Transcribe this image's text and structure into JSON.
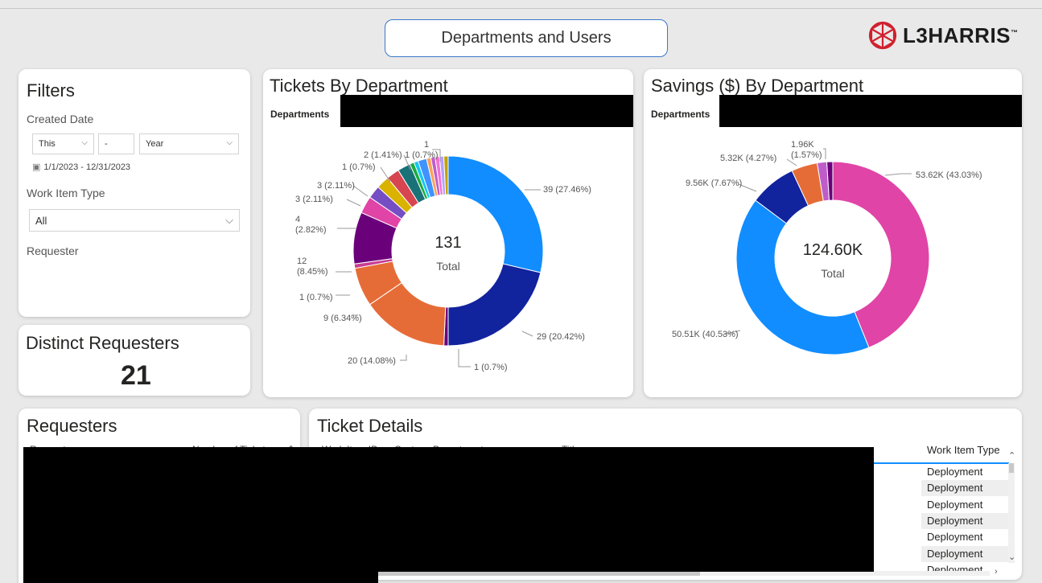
{
  "header": {
    "title_button": "Departments and Users",
    "logo_text": "L3HARRIS",
    "logo_tm": "™"
  },
  "filters": {
    "title": "Filters",
    "created_date_label": "Created Date",
    "relative_mode": "This",
    "relative_count": "-",
    "relative_unit": "Year",
    "date_range": "1/1/2023 - 12/31/2023",
    "work_item_type_label": "Work Item Type",
    "work_item_type_value": "All",
    "requester_label": "Requester"
  },
  "distinct_requesters": {
    "title": "Distinct Requesters",
    "value": "21"
  },
  "tickets_chart": {
    "title": "Tickets By Department",
    "legend_label": "Departments",
    "center_value": "131",
    "center_label": "Total"
  },
  "savings_chart": {
    "title": "Savings ($) By Department",
    "legend_label": "Departments",
    "center_value": "124.60K",
    "center_label": "Total"
  },
  "requesters": {
    "title": "Requesters",
    "col_requester": "Requester",
    "col_tickets": "Number of Tickets"
  },
  "ticket_details": {
    "title": "Ticket Details",
    "col_work_item_id": "Work Item ID",
    "col_department": "Custom_Department",
    "col_title": "Title",
    "col_work_item_type": "Work Item Type",
    "work_item_types": [
      "Deployment",
      "Deployment",
      "Deployment",
      "Deployment",
      "Deployment",
      "Deployment",
      "Deployment"
    ]
  },
  "chart_data": [
    {
      "type": "pie",
      "title": "Tickets By Department",
      "legend_title": "Departments",
      "total": 131,
      "slices": [
        {
          "value": 39,
          "label": "39 (27.46%)",
          "color": "#118dff"
        },
        {
          "value": 29,
          "label": "29 (20.42%)",
          "color": "#12239e"
        },
        {
          "value": 1,
          "label": "1 (0.7%)",
          "color": "#6b007b"
        },
        {
          "value": 20,
          "label": "20 (14.08%)",
          "color": "#e66c37"
        },
        {
          "value": 9,
          "label": "9 (6.34%)",
          "color": "#e66c37"
        },
        {
          "value": 1,
          "label": "1 (0.7%)",
          "color": "#c83d95"
        },
        {
          "value": 12,
          "label": "12 (8.45%)",
          "color": "#6b007b"
        },
        {
          "value": 4,
          "label": "4 (2.82%)",
          "color": "#e044a7"
        },
        {
          "value": 3,
          "label": "3 (2.11%)",
          "color": "#744ec2"
        },
        {
          "value": 3,
          "label": "3 (2.11%)",
          "color": "#d9b300"
        },
        {
          "value": 3,
          "label": "",
          "color": "#d64550"
        },
        {
          "value": 3,
          "label": "",
          "color": "#197278"
        },
        {
          "value": 1,
          "label": "1 (0.7%)",
          "color": "#1aab40"
        },
        {
          "value": 1,
          "label": "",
          "color": "#15c6f4"
        },
        {
          "value": 2,
          "label": "2 (1.41%)",
          "color": "#4092ff"
        },
        {
          "value": 1,
          "label": "1 (0.7%)",
          "color": "#ffa058"
        },
        {
          "value": 1,
          "label": "",
          "color": "#be5dc9"
        },
        {
          "value": 1,
          "label": "1",
          "color": "#f472d0"
        },
        {
          "value": 1,
          "label": "",
          "color": "#b5a1ff"
        },
        {
          "value": 1,
          "label": "",
          "color": "#c4a200"
        }
      ]
    },
    {
      "type": "pie",
      "title": "Savings ($) By Department",
      "legend_title": "Departments",
      "total": "124.60K",
      "slices": [
        {
          "value": 53.62,
          "label": "53.62K (43.03%)",
          "color": "#e044a7"
        },
        {
          "value": 50.51,
          "label": "50.51K (40.53%)",
          "color": "#118dff"
        },
        {
          "value": 9.56,
          "label": "9.56K (7.67%)",
          "color": "#12239e"
        },
        {
          "value": 5.32,
          "label": "5.32K (4.27%)",
          "color": "#e66c37"
        },
        {
          "value": 1.96,
          "label": "1.96K (1.57%)",
          "color": "#be5dc9"
        },
        {
          "value": 1.21,
          "label": "",
          "color": "#6b007b"
        }
      ]
    }
  ]
}
